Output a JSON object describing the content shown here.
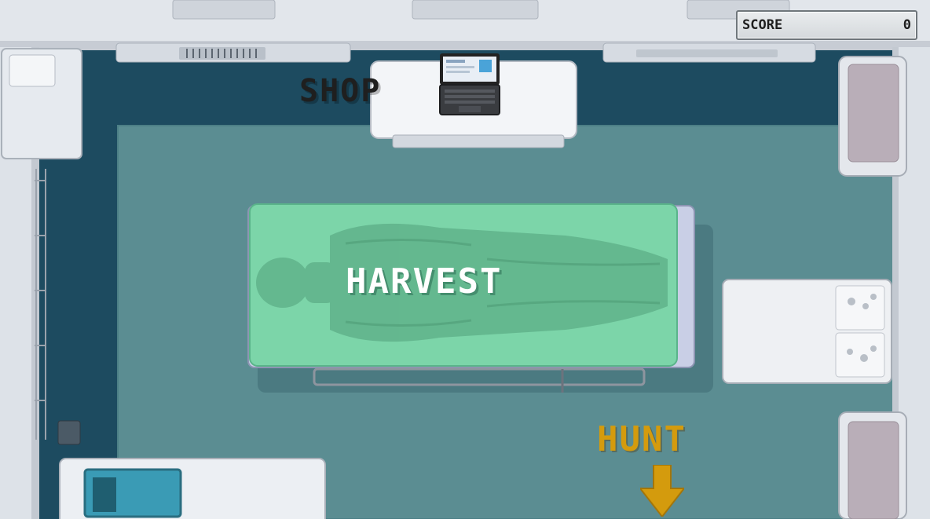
{
  "hud": {
    "score_label": "SCORE",
    "score_value": "0"
  },
  "stations": {
    "shop": {
      "label": "SHOP",
      "icon": "laptop-icon"
    },
    "harvest": {
      "label": "HARVEST",
      "icon": "covered-body-gurney"
    },
    "hunt": {
      "label": "HUNT",
      "icon": "arrow-down-icon"
    }
  },
  "colors": {
    "floor_dark": "#1c4a5f",
    "floor_rug": "#5a8c91",
    "wall": "#dfe3e8",
    "sheet": "#79d6a8",
    "hunt_gold": "#d49b0d",
    "shop_text": "#1f1f1f",
    "harvest_text": "#ffffff"
  }
}
